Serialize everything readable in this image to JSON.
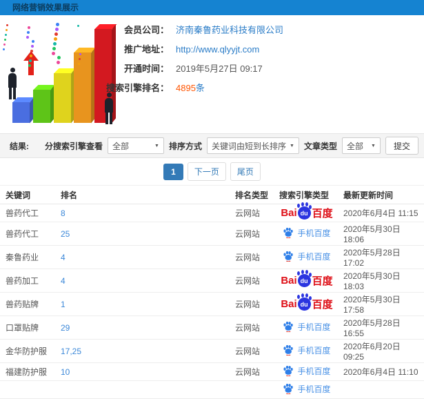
{
  "header": {
    "title": "网络营销效果展示",
    "accent_color": "#1583d1"
  },
  "profile": {
    "fields": [
      {
        "label": "会员公司：",
        "value": "济南秦鲁药业科技有限公司",
        "type": "link"
      },
      {
        "label": "推广地址：",
        "value": "http://www.qlyyjt.com",
        "type": "link"
      },
      {
        "label": "开通时间：",
        "value": "2019年5月27日 09:17",
        "type": "text"
      },
      {
        "label": "搜索引擎排名：",
        "value": "4895",
        "suffix": "条",
        "type": "highlight"
      }
    ]
  },
  "filters": {
    "section_label": "结果:",
    "engine_label": "分搜索引擎查看",
    "engine_value": "全部",
    "sort_label": "排序方式",
    "sort_value": "关键词由短到长排序",
    "article_label": "文章类型",
    "article_value": "全部",
    "submit_label": "提交"
  },
  "pagination": {
    "current": "1",
    "next_label": "下一页",
    "last_label": "尾页"
  },
  "table": {
    "headers": [
      "关键词",
      "排名",
      "排名类型",
      "搜索引擎类型",
      "最新更新时间"
    ],
    "engine_labels": {
      "baidu_bai": "Bai",
      "baidu_du": "du",
      "baidu_cn": "百度",
      "mobile_baidu": "手机百度"
    },
    "rows": [
      {
        "keyword": "兽药代工",
        "rank": "8",
        "rank_type": "云网站",
        "engine": "baidu",
        "time": "2020年6月4日 11:15"
      },
      {
        "keyword": "兽药代工",
        "rank": "25",
        "rank_type": "云网站",
        "engine": "mobile-baidu",
        "time": "2020年5月30日 18:06"
      },
      {
        "keyword": "秦鲁药业",
        "rank": "4",
        "rank_type": "云网站",
        "engine": "mobile-baidu",
        "time": "2020年5月28日 17:02"
      },
      {
        "keyword": "兽药加工",
        "rank": "4",
        "rank_type": "云网站",
        "engine": "baidu",
        "time": "2020年5月30日 18:03"
      },
      {
        "keyword": "兽药贴牌",
        "rank": "1",
        "rank_type": "云网站",
        "engine": "baidu",
        "time": "2020年5月30日 17:58"
      },
      {
        "keyword": "口罩贴牌",
        "rank": "29",
        "rank_type": "云网站",
        "engine": "mobile-baidu",
        "time": "2020年5月28日 16:55"
      },
      {
        "keyword": "金华防护服",
        "rank": "17,25",
        "rank_type": "云网站",
        "engine": "mobile-baidu",
        "time": "2020年6月20日 09:25"
      },
      {
        "keyword": "福建防护服",
        "rank": "10",
        "rank_type": "云网站",
        "engine": "mobile-baidu",
        "time": "2020年6月4日 11:10"
      },
      {
        "keyword": "",
        "rank": "",
        "rank_type": "",
        "engine": "mobile-baidu",
        "time": ""
      }
    ]
  },
  "illustration": {
    "confetti_colors": [
      "#e23a2e",
      "#3b82f6",
      "#22c55e",
      "#f59e0b",
      "#a855f7",
      "#ec4899",
      "#14b8a6"
    ]
  }
}
